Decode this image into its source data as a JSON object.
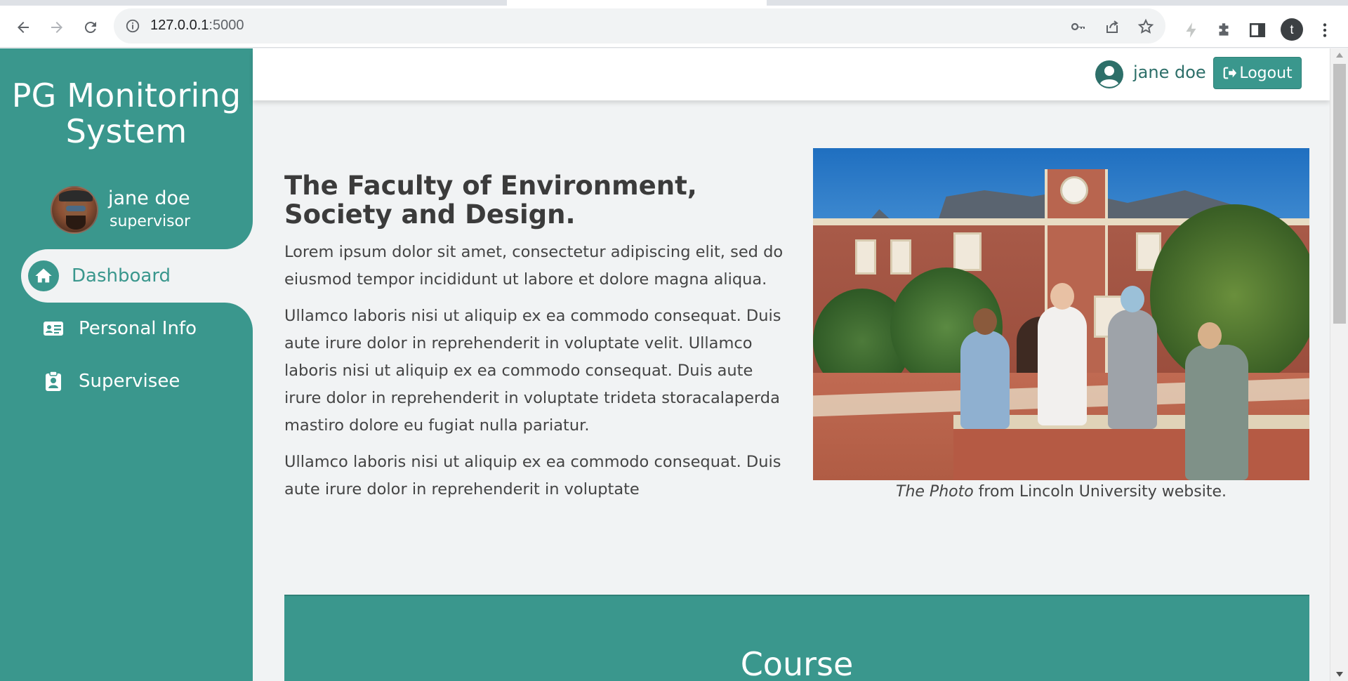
{
  "browser": {
    "url_host": "127.0.0.1",
    "url_port": ":5000",
    "profile_initial": "t"
  },
  "sidebar": {
    "brand": "PG Monitoring System",
    "user": {
      "name": "jane doe",
      "role": "supervisor"
    },
    "items": [
      {
        "label": "Dashboard",
        "icon": "home-icon",
        "active": true
      },
      {
        "label": "Personal Info",
        "icon": "id-card-icon",
        "active": false
      },
      {
        "label": "Supervisee",
        "icon": "clipboard-user-icon",
        "active": false
      }
    ]
  },
  "header": {
    "user_name": "jane doe",
    "logout_label": "Logout"
  },
  "main": {
    "heading": "The Faculty of Environment, Society and Design.",
    "paragraphs": [
      "Lorem ipsum dolor sit amet, consectetur adipiscing elit, sed do eiusmod tempor incididunt ut labore et dolore magna aliqua.",
      "Ullamco laboris nisi ut aliquip ex ea commodo consequat. Duis aute irure dolor in reprehenderit in voluptate velit. Ullamco laboris nisi ut aliquip ex ea commodo consequat. Duis aute irure dolor in reprehenderit in voluptate trideta storacalaperda mastiro dolore eu fugiat nulla pariatur.",
      "Ullamco laboris nisi ut aliquip ex ea commodo consequat. Duis aute irure dolor in reprehenderit in voluptate"
    ],
    "caption_emphasis": "The Photo",
    "caption_rest": " from Lincoln University website.",
    "course_title": "Course"
  },
  "colors": {
    "accent": "#3a978d",
    "background": "#f1f3f4"
  }
}
